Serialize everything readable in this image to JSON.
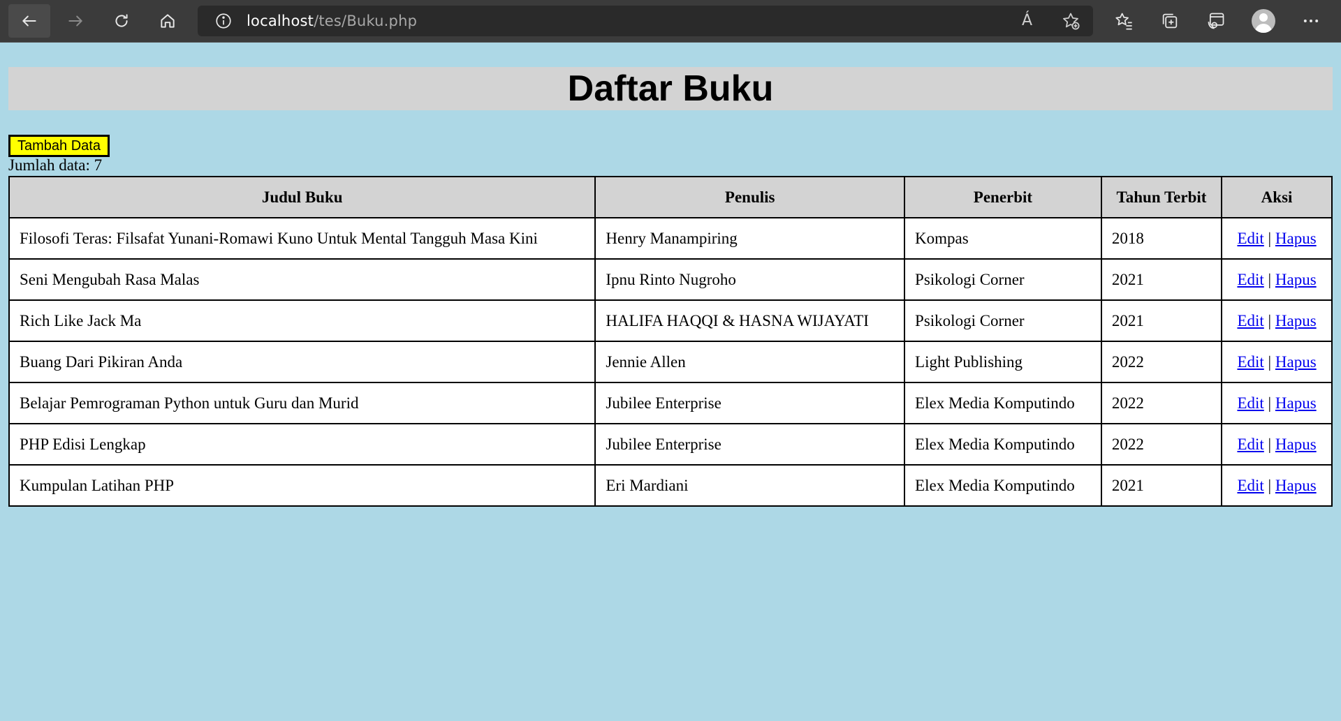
{
  "browser": {
    "url_host": "localhost",
    "url_path": "/tes/Buku.php",
    "toolbar_icons": [
      "back-icon",
      "forward-icon",
      "refresh-icon",
      "home-icon",
      "site-info-icon",
      "read-aloud-icon",
      "add-favorite-icon",
      "favorites-icon",
      "collections-icon",
      "browser-essentials-icon",
      "profile-avatar",
      "more-icon"
    ],
    "read_aloud_glyph": "Á"
  },
  "page": {
    "title": "Daftar Buku",
    "add_button_label": "Tambah Data",
    "count_label": "Jumlah data: ",
    "count_value": "7",
    "background_color": "#add8e6",
    "header_bg_color": "#d3d3d3",
    "button_color": "#ffff00"
  },
  "table": {
    "headers": {
      "judul": "Judul Buku",
      "penulis": "Penulis",
      "penerbit": "Penerbit",
      "tahun": "Tahun Terbit",
      "aksi": "Aksi"
    },
    "edit_label": "Edit",
    "separator": "|",
    "delete_label": "Hapus",
    "rows": [
      {
        "judul": "Filosofi Teras: Filsafat Yunani-Romawi Kuno Untuk Mental Tangguh Masa Kini",
        "penulis": "Henry Manampiring",
        "penerbit": "Kompas",
        "tahun": "2018"
      },
      {
        "judul": "Seni Mengubah Rasa Malas",
        "penulis": "Ipnu Rinto Nugroho",
        "penerbit": "Psikologi Corner",
        "tahun": "2021"
      },
      {
        "judul": "Rich Like Jack Ma",
        "penulis": "HALIFA HAQQI & HASNA WIJAYATI",
        "penerbit": "Psikologi Corner",
        "tahun": "2021"
      },
      {
        "judul": "Buang Dari Pikiran Anda",
        "penulis": "Jennie Allen",
        "penerbit": "Light Publishing",
        "tahun": "2022"
      },
      {
        "judul": "Belajar Pemrograman Python untuk Guru dan Murid",
        "penulis": "Jubilee Enterprise",
        "penerbit": "Elex Media Komputindo",
        "tahun": "2022"
      },
      {
        "judul": "PHP Edisi Lengkap",
        "penulis": "Jubilee Enterprise",
        "penerbit": "Elex Media Komputindo",
        "tahun": "2022"
      },
      {
        "judul": "Kumpulan Latihan PHP",
        "penulis": "Eri Mardiani",
        "penerbit": "Elex Media Komputindo",
        "tahun": "2021"
      }
    ]
  }
}
